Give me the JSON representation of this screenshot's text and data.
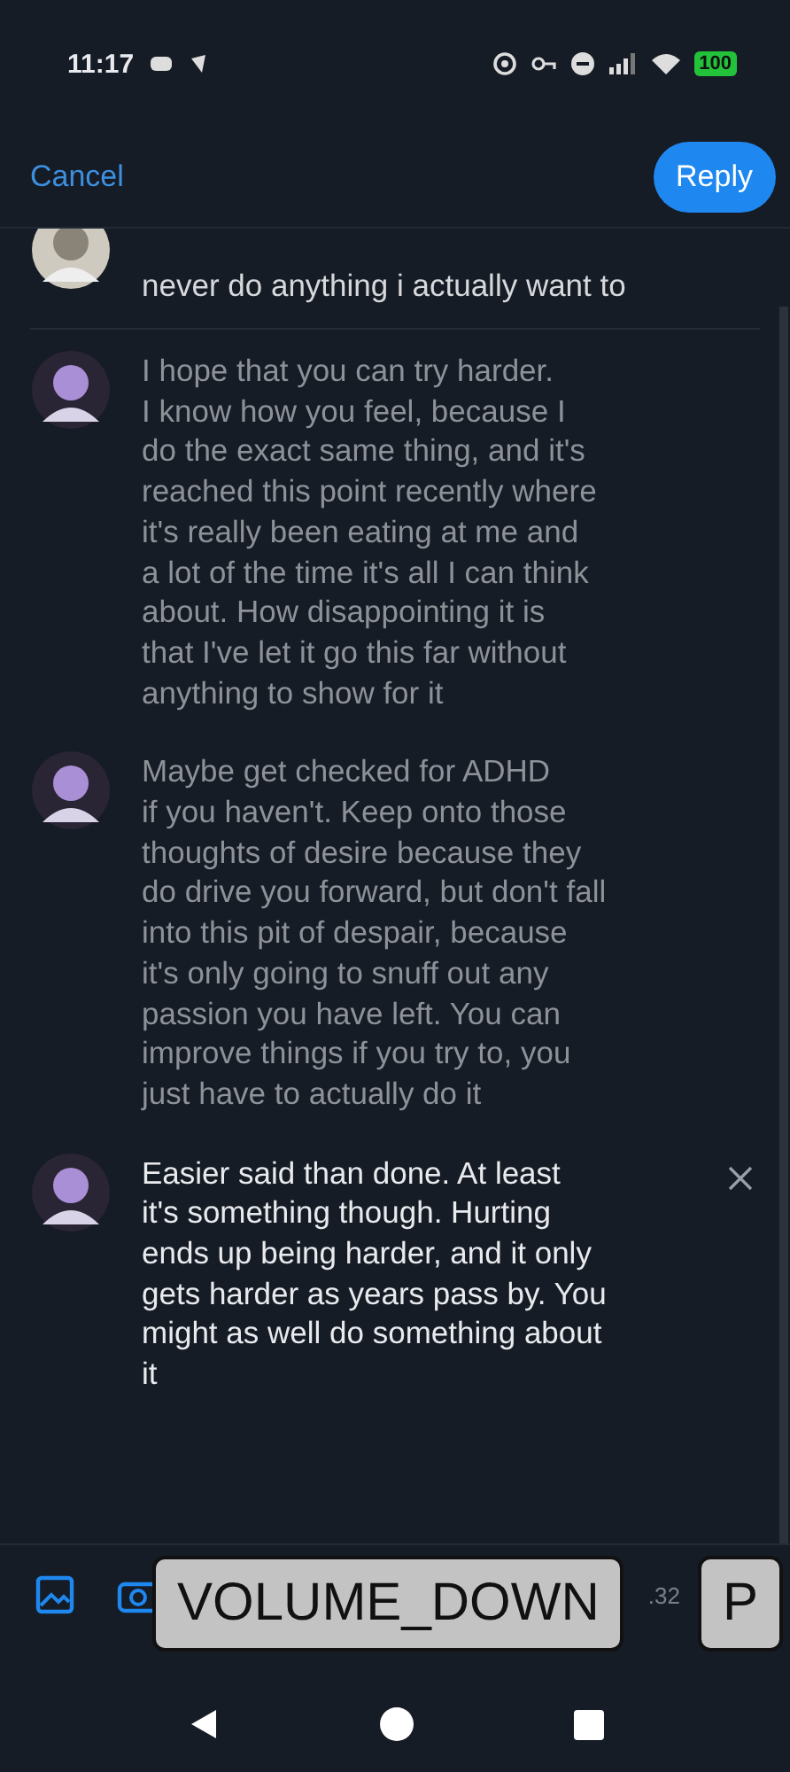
{
  "status_bar": {
    "time": "11:17",
    "battery": "100"
  },
  "header": {
    "cancel": "Cancel",
    "reply": "Reply"
  },
  "comments": [
    {
      "lines": [
        "never do anything i actually want to"
      ]
    },
    {
      "lines": [
        "I hope that you can try harder.",
        "I know how you feel, because I",
        "do the exact same thing, and it's",
        "reached this point recently where",
        "it's really been eating at me and",
        "a lot of the time it's all I can think",
        "about. How disappointing it is",
        "that I've let it go this far without",
        "anything to show for it"
      ]
    },
    {
      "lines": [
        "Maybe get checked for ADHD",
        "if you haven't. Keep onto those",
        "thoughts of desire because they",
        "do drive you forward, but don't fall",
        "into this pit of despair, because",
        "it's only going to snuff out any",
        "passion you have left. You can",
        "improve things if you try to, you",
        "just have to actually do it"
      ]
    }
  ],
  "draft": {
    "value": "Easier said than done. At least\nit's something though. Hurting\nends up being harder, and it only\ngets harder as years pass by. You\nmight as well do something about\nit"
  },
  "toolbar": {
    "count": ".32"
  },
  "key_overlays": [
    "VOLUME_DOWN",
    "P"
  ]
}
